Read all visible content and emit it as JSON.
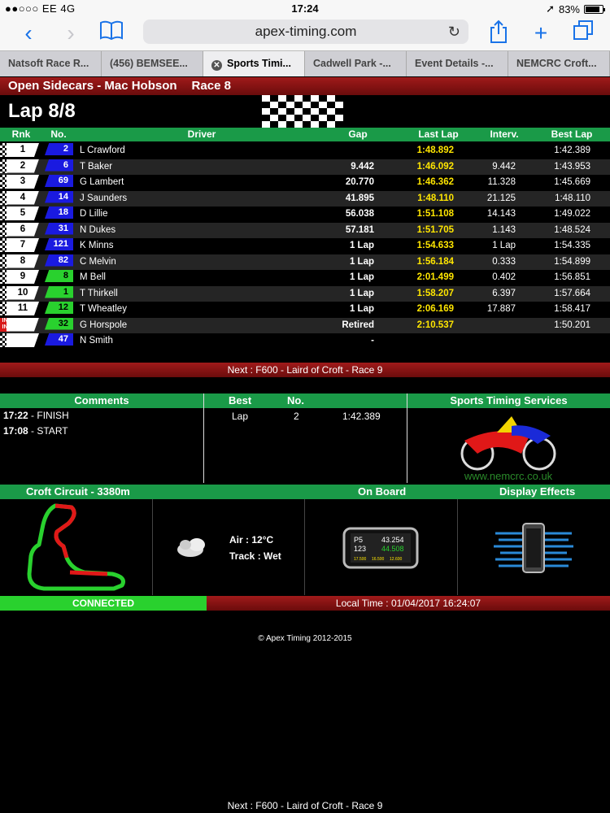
{
  "status": {
    "carrier": "●●○○○ EE  4G",
    "time": "17:24",
    "battery": "83%",
    "battery_level": 0.83
  },
  "browser": {
    "url": "apex-timing.com",
    "tabs": [
      "Natsoft Race R...",
      "(456) BEMSEE...",
      "Sports Timi...",
      "Cadwell Park -...",
      "Event Details -...",
      "NEMCRC Croft..."
    ],
    "active_tab": 2
  },
  "race": {
    "class": "Open Sidecars - Mac Hobson",
    "race": "Race 8",
    "lap": "Lap 8/8"
  },
  "table": {
    "headers": {
      "rnk": "Rnk",
      "no": "No.",
      "driver": "Driver",
      "gap": "Gap",
      "last": "Last Lap",
      "interval": "Interv.",
      "best": "Best Lap"
    },
    "rows": [
      {
        "rnk": "1",
        "no": "2",
        "noColor": "blue",
        "driver": "L Crawford",
        "gap": "",
        "last": "1:48.892",
        "interval": "",
        "best": "1:42.389"
      },
      {
        "rnk": "2",
        "no": "6",
        "noColor": "blue",
        "driver": "T Baker",
        "gap": "9.442",
        "last": "1:46.092",
        "interval": "9.442",
        "best": "1:43.953"
      },
      {
        "rnk": "3",
        "no": "69",
        "noColor": "blue",
        "driver": "G Lambert",
        "gap": "20.770",
        "last": "1:46.362",
        "interval": "11.328",
        "best": "1:45.669"
      },
      {
        "rnk": "4",
        "no": "14",
        "noColor": "blue",
        "driver": "J Saunders",
        "gap": "41.895",
        "last": "1:48.110",
        "interval": "21.125",
        "best": "1:48.110"
      },
      {
        "rnk": "5",
        "no": "18",
        "noColor": "blue",
        "driver": "D Lillie",
        "gap": "56.038",
        "last": "1:51.108",
        "interval": "14.143",
        "best": "1:49.022"
      },
      {
        "rnk": "6",
        "no": "31",
        "noColor": "blue",
        "driver": "N Dukes",
        "gap": "57.181",
        "last": "1:51.705",
        "interval": "1.143",
        "best": "1:48.524"
      },
      {
        "rnk": "7",
        "no": "121",
        "noColor": "blue",
        "driver": "K Minns",
        "gap": "1 Lap",
        "last": "1:54.633",
        "interval": "1 Lap",
        "best": "1:54.335"
      },
      {
        "rnk": "8",
        "no": "82",
        "noColor": "blue",
        "driver": "C Melvin",
        "gap": "1 Lap",
        "last": "1:56.184",
        "interval": "0.333",
        "best": "1:54.899"
      },
      {
        "rnk": "9",
        "no": "8",
        "noColor": "green",
        "driver": "M Bell",
        "gap": "1 Lap",
        "last": "2:01.499",
        "interval": "0.402",
        "best": "1:56.851"
      },
      {
        "rnk": "10",
        "no": "1",
        "noColor": "green",
        "driver": "T Thirkell",
        "gap": "1 Lap",
        "last": "1:58.207",
        "interval": "6.397",
        "best": "1:57.664"
      },
      {
        "rnk": "11",
        "no": "12",
        "noColor": "green",
        "driver": "T Wheatley",
        "gap": "1 Lap",
        "last": "2:06.169",
        "interval": "17.887",
        "best": "1:58.417"
      },
      {
        "rnk": "",
        "no": "32",
        "noColor": "green",
        "driver": "G Horspole",
        "gap": "Retired",
        "last": "2:10.537",
        "interval": "",
        "best": "1:50.201",
        "pit": "IN IN"
      },
      {
        "rnk": "",
        "no": "47",
        "noColor": "blue",
        "driver": "N Smith",
        "gap": "-",
        "last": "",
        "interval": "",
        "best": ""
      }
    ]
  },
  "next": "Next : F600 - Laird of Croft - Race 9",
  "comments": {
    "title": "Comments",
    "items": [
      {
        "time": "17:22",
        "text": " - FINISH"
      },
      {
        "time": "17:08",
        "text": " - START"
      }
    ]
  },
  "best": {
    "title_best": "Best",
    "title_no": "No.",
    "label": "Lap",
    "no": "2",
    "time": "1:42.389"
  },
  "sts": {
    "title": "Sports Timing Services",
    "url": "www.nemcrc.co.uk"
  },
  "circuit": {
    "name": "Croft Circuit - 3380m",
    "onboard": "On Board",
    "effects": "Display Effects"
  },
  "weather": {
    "air": "Air : 12°C",
    "track": "Track : Wet"
  },
  "onboard": {
    "pos": "P5",
    "time1": "43.254",
    "lap": "123",
    "time2": "44.508",
    "s1": "17.500",
    "s2": "16.500",
    "s3": "12.600"
  },
  "connection": "CONNECTED",
  "localtime": "Local Time : 01/04/2017 16:24:07",
  "copyright": "© Apex Timing 2012-2015",
  "bottom_next": "Next : F600 - Laird of Croft - Race 9"
}
